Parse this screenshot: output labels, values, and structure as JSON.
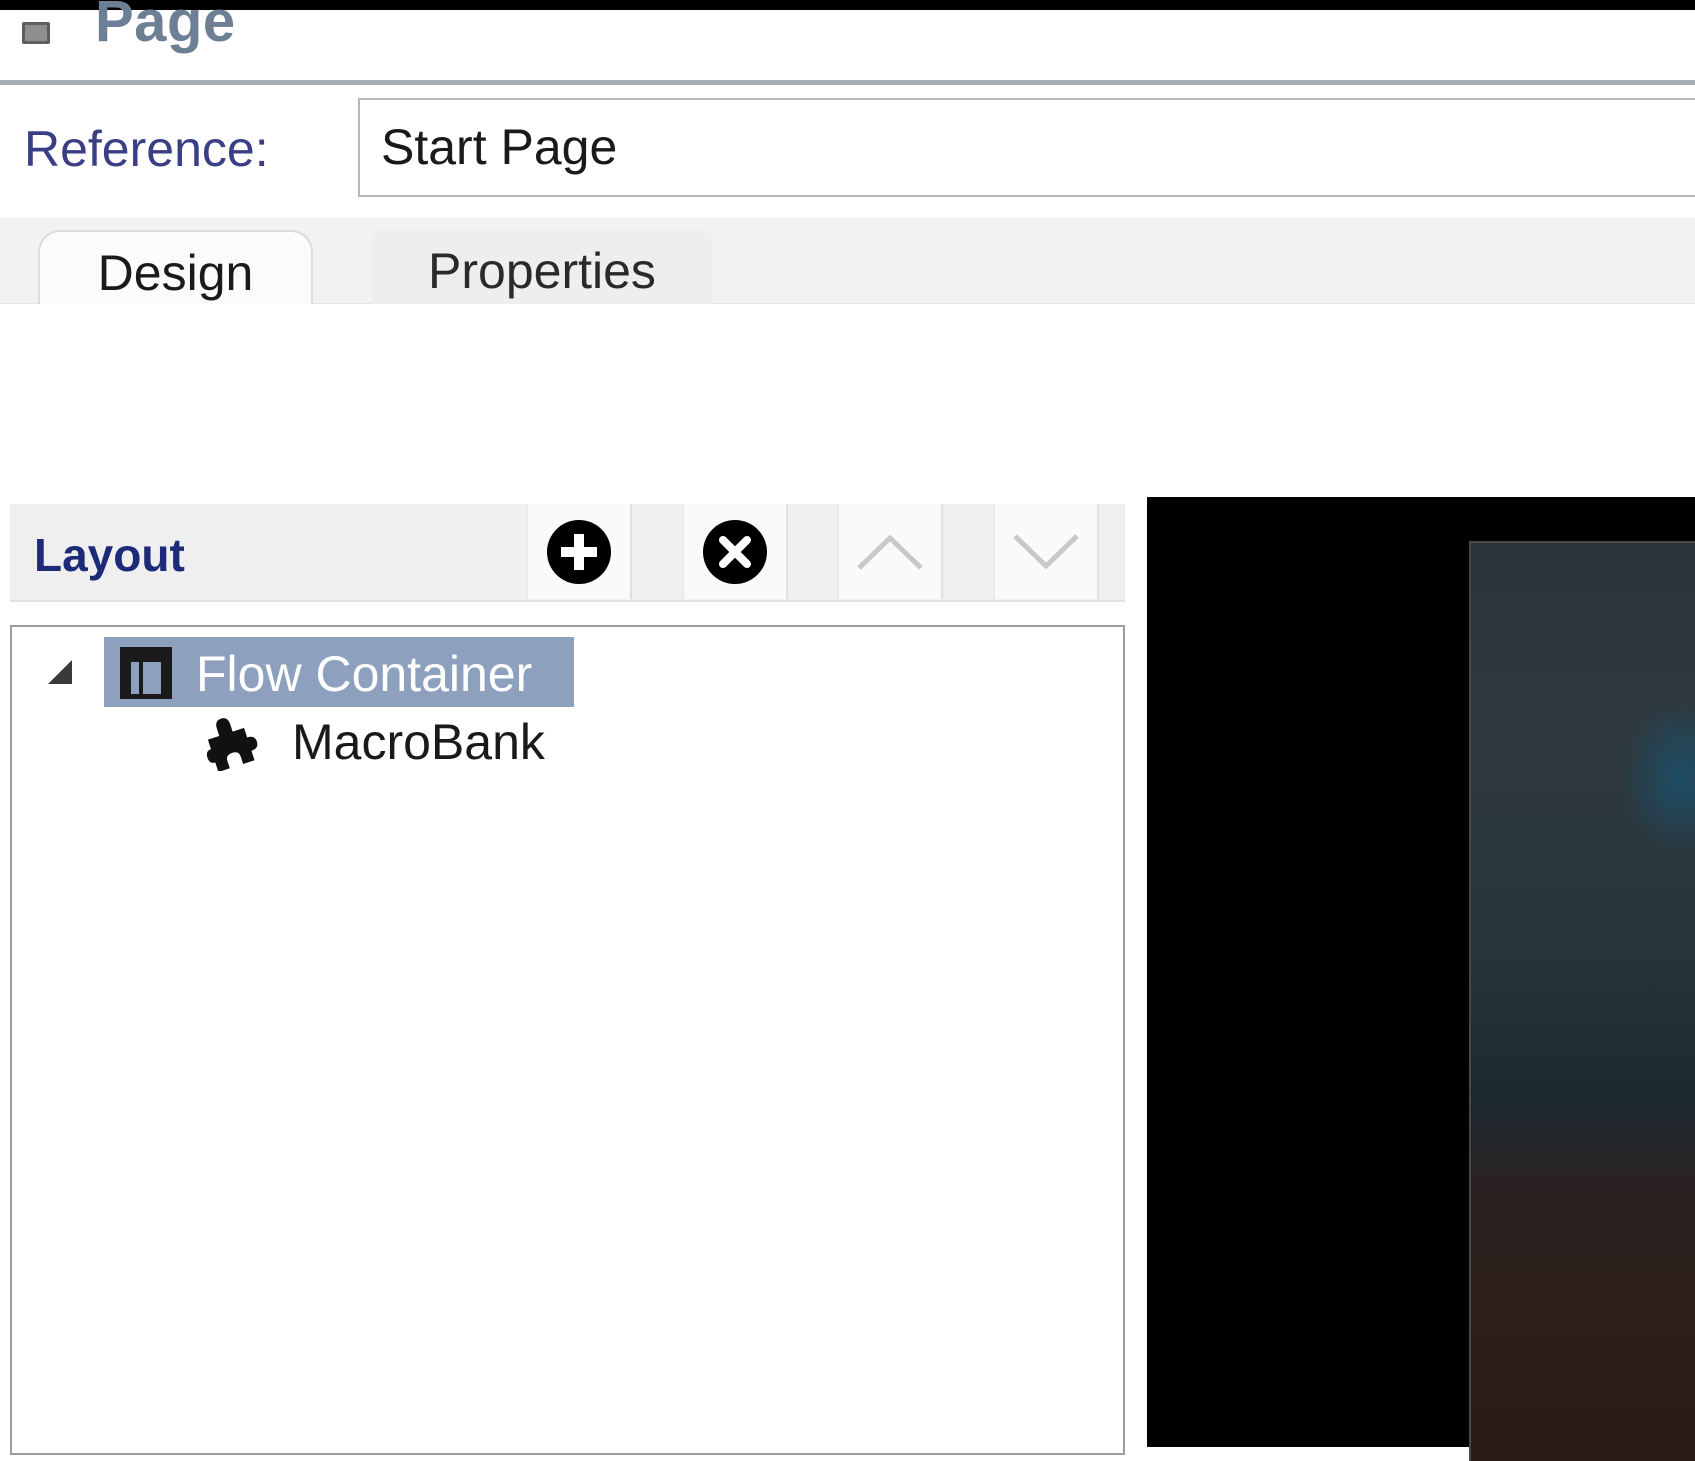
{
  "panel": {
    "title": "Page",
    "icon": "page-icon"
  },
  "reference": {
    "label": "Reference:",
    "value": "Start Page"
  },
  "tabs": [
    {
      "label": "Design",
      "active": true
    },
    {
      "label": "Properties",
      "active": false
    }
  ],
  "layout": {
    "title": "Layout",
    "buttons": [
      {
        "icon": "add-icon"
      },
      {
        "icon": "remove-icon"
      },
      {
        "icon": "move-up-icon"
      },
      {
        "icon": "move-down-icon"
      }
    ],
    "tree": {
      "root": {
        "label": "Flow Container",
        "icon": "container-icon",
        "expanded": true,
        "selected": true
      },
      "children": [
        {
          "label": "MacroBank",
          "icon": "puzzle-icon"
        }
      ]
    }
  },
  "colors": {
    "selection": "#8da0bd",
    "label_blue": "#3a3e84",
    "layout_title": "#1d2a78"
  }
}
